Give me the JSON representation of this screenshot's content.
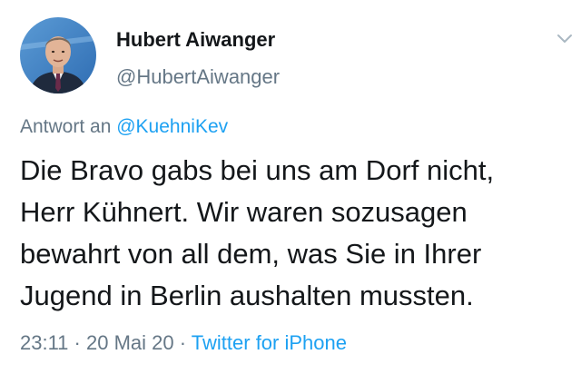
{
  "author": {
    "name": "Hubert Aiwanger",
    "handle": "@HubertAiwanger",
    "avatar_icon": "user-avatar-photo"
  },
  "reply": {
    "prefix": "Antwort an",
    "mention": "@KuehniKev"
  },
  "tweet": {
    "lines": [
      "Die Bravo gabs bei uns am Dorf nicht,",
      "Herr Kühnert. Wir waren sozusagen",
      "bewahrt von all dem, was Sie in Ihrer",
      "Jugend in Berlin aushalten mussten."
    ]
  },
  "meta": {
    "time": "23:11",
    "separator": "·",
    "date": "20 Mai 20",
    "source": "Twitter for iPhone"
  },
  "colors": {
    "text_primary": "#14171a",
    "text_secondary": "#657786",
    "link": "#1da1f2"
  },
  "icons": {
    "menu": "chevron-down-icon"
  }
}
